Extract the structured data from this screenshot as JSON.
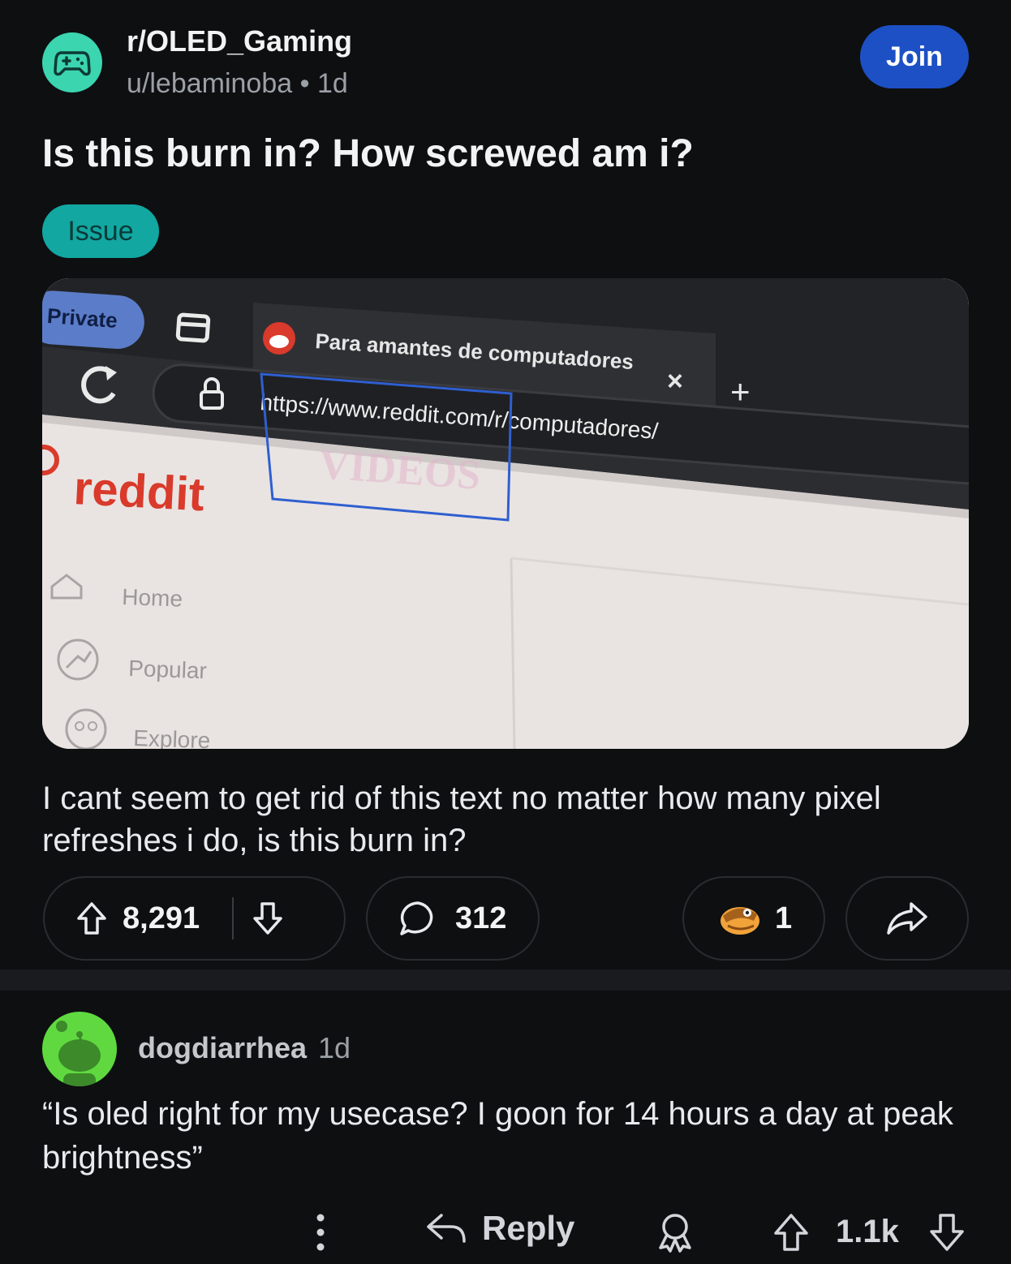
{
  "post": {
    "subreddit": "r/OLED_Gaming",
    "author": "u/lebaminoba",
    "separator": "•",
    "age": "1d",
    "join_label": "Join",
    "title": "Is this burn in? How screwed am i?",
    "flair": "Issue",
    "body": "I cant seem to get rid of this text no matter how many pixel refreshes i do, is this burn in?",
    "upvotes": "8,291",
    "comments": "312",
    "awards": "1"
  },
  "image": {
    "private_badge": "Private",
    "tab_title": "Para amantes de computadores",
    "tab_close": "×",
    "new_tab": "+",
    "url": "https://www.reddit.com/r/computadores/",
    "logo": "reddit",
    "ghost_text": "VIDEOS",
    "nav": [
      "Home",
      "Popular",
      "Explore"
    ]
  },
  "comment": {
    "author": "dogdiarrhea",
    "age": "1d",
    "text": "“Is oled right for my usecase? I goon for 14 hours a day at peak brightness”",
    "reply_label": "Reply",
    "score": "1.1k"
  },
  "colors": {
    "join": "#1d50c4",
    "flair": "#12a7a1",
    "subreddit_avatar": "#3bd5b0",
    "commenter_avatar": "#5fd93f",
    "reddit_red": "#d93a2b",
    "annotation": "#2f5fd0"
  },
  "icons": [
    "controller-icon",
    "upvote-icon",
    "downvote-icon",
    "comment-icon",
    "award-icon",
    "share-icon",
    "more-icon",
    "reply-icon",
    "award-outline-icon",
    "snoo-icon",
    "reload-icon",
    "lock-icon",
    "tabs-icon",
    "home-icon",
    "popular-icon",
    "explore-icon"
  ]
}
